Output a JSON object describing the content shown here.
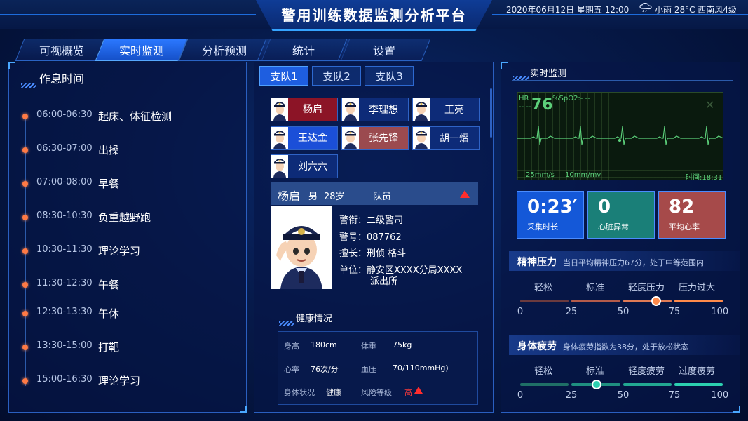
{
  "header": {
    "title": "警用训练数据监测分析平台",
    "datetime": "2020年06月12日  星期五  12:00",
    "weather_icon": "cloud-rain-icon",
    "weather": "小雨    28°C    西南风4级"
  },
  "nav": {
    "tabs": [
      "可视概览",
      "实时监测",
      "分析预测",
      "统计",
      "设置"
    ],
    "active": "实时监测"
  },
  "schedule": {
    "title": "作息时间",
    "items": [
      {
        "time": "06:00-06:30",
        "activity": "起床、体征检测"
      },
      {
        "time": "06:30-07:00",
        "activity": "出操"
      },
      {
        "time": "07:00-08:00",
        "activity": "早餐"
      },
      {
        "time": "08:30-10:30",
        "activity": "负重越野跑"
      },
      {
        "time": "10:30-11:30",
        "activity": "理论学习"
      },
      {
        "time": "11:30-12:30",
        "activity": "午餐"
      },
      {
        "time": "12:30-13:30",
        "activity": "午休"
      },
      {
        "time": "13:30-15:00",
        "activity": "打靶"
      },
      {
        "time": "15:00-16:30",
        "activity": "理论学习"
      }
    ]
  },
  "squads": {
    "tabs": [
      "支队1",
      "支队2",
      "支队3"
    ],
    "active": "支队1",
    "members": [
      {
        "name": "杨启",
        "style": "red"
      },
      {
        "name": "李理想",
        "style": "default"
      },
      {
        "name": "王亮",
        "style": "default"
      },
      {
        "name": "王达金",
        "style": "blue"
      },
      {
        "name": "张先锋",
        "style": "rose"
      },
      {
        "name": "胡一熠",
        "style": "default"
      },
      {
        "name": "刘六六",
        "style": "default"
      }
    ]
  },
  "detail": {
    "name": "杨启",
    "gender": "男",
    "age": "28岁",
    "role": "队员",
    "rank": "警衔：二级警司",
    "badge": "警号：087762",
    "skill": "擅长：刑侦 格斗",
    "unit_line1": "单位：静安区XXXX分局XXXX",
    "unit_line2": "派出所",
    "health_title": "健康情况",
    "health": {
      "height_label": "身高",
      "height": "180cm",
      "weight_label": "体重",
      "weight": "75kg",
      "hr_label": "心率",
      "hr": "76次/分",
      "bp_label": "血压",
      "bp": "70/110mmHg)",
      "status_label": "身体状况",
      "status": "健康",
      "risk_label": "风险等级",
      "risk": "高"
    }
  },
  "realtime": {
    "title": "实时监测",
    "ecg": {
      "hr_label": "HR",
      "hr_dash": "-- --",
      "hr_value": "76",
      "spo2": "%SpO2:-  --",
      "speed": "25mm/s",
      "gain": "10mm/mv",
      "time": "时间:18:31"
    },
    "stats": [
      {
        "value": "0:23′",
        "label": "采集时长",
        "color": "#1458d8"
      },
      {
        "value": "0",
        "label": "心脏异常",
        "color": "#1a7f78"
      },
      {
        "value": "82",
        "label": "平均心率",
        "color": "#a64a4a"
      }
    ],
    "stress": {
      "title": "精神压力",
      "subtitle": "当日平均精神压力67分，处于中等范围内",
      "levels": [
        "轻松",
        "标准",
        "轻度压力",
        "压力过大"
      ],
      "ticks": [
        "0",
        "25",
        "50",
        "75",
        "100"
      ],
      "value": 67,
      "colors": [
        "#6b3a3e",
        "#b45b4a",
        "#e07a55",
        "#ff8a4a"
      ]
    },
    "fatigue": {
      "title": "身体疲劳",
      "subtitle": "身体疲劳指数为38分，处于放松状态",
      "levels": [
        "轻松",
        "标准",
        "轻度疲劳",
        "过度疲劳"
      ],
      "ticks": [
        "0",
        "25",
        "50",
        "75",
        "100"
      ],
      "value": 38,
      "colors": [
        "#1f6f66",
        "#1f8f80",
        "#22a892",
        "#2cd0b0"
      ]
    }
  }
}
